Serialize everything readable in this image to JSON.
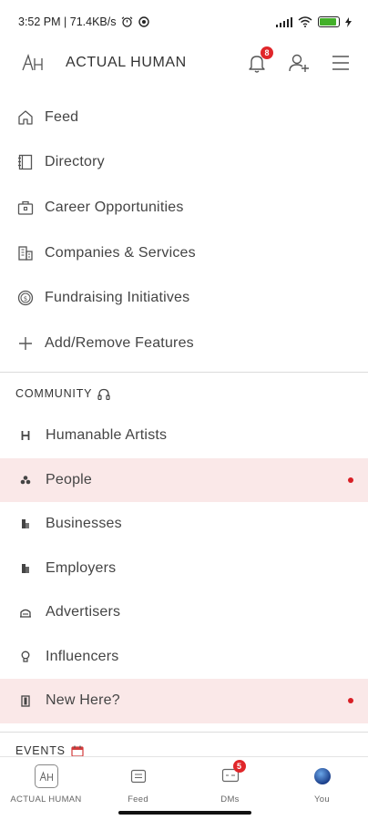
{
  "status_bar": {
    "time_speed": "3:52 PM | 71.4KB/s",
    "battery_level": 0.9,
    "colors": {
      "battery": "#43b02a"
    }
  },
  "header": {
    "logo_text": "AH",
    "title": "ACTUAL HUMAN",
    "notification_count": "8",
    "icons": [
      "bell-icon",
      "add-user-icon",
      "hamburger-menu-icon"
    ]
  },
  "menu": {
    "items": [
      {
        "label": "Feed",
        "icon": "home-icon"
      },
      {
        "label": "Directory",
        "icon": "directory-icon"
      },
      {
        "label": "Career Opportunities",
        "icon": "briefcase-icon"
      },
      {
        "label": "Companies & Services",
        "icon": "building-icon"
      },
      {
        "label": "Fundraising Initiatives",
        "icon": "dollar-coin-icon"
      },
      {
        "label": "Add/Remove Features",
        "icon": "plus-icon"
      }
    ]
  },
  "community": {
    "header": "COMMUNITY",
    "header_icon": "headphones-icon",
    "items": [
      {
        "label": "Humanable Artists",
        "icon": "h-icon",
        "highlighted": false
      },
      {
        "label": "People",
        "icon": "people-icon",
        "highlighted": true,
        "unread_dot": true
      },
      {
        "label": "Businesses",
        "icon": "business-icon",
        "highlighted": false
      },
      {
        "label": "Employers",
        "icon": "employer-icon",
        "highlighted": false
      },
      {
        "label": "Advertisers",
        "icon": "advertiser-icon",
        "highlighted": false
      },
      {
        "label": "Influencers",
        "icon": "influencer-icon",
        "highlighted": false
      },
      {
        "label": "New Here?",
        "icon": "door-icon",
        "highlighted": true,
        "unread_dot": true
      }
    ]
  },
  "events": {
    "header": "EVENTS",
    "header_icon": "calendar-icon"
  },
  "bottom_nav": {
    "tabs": [
      {
        "label": "ACTUAL HUMAN",
        "icon": "ah-logo-icon"
      },
      {
        "label": "Feed",
        "icon": "feed-icon"
      },
      {
        "label": "DMs",
        "icon": "chat-icon",
        "badge": "5"
      },
      {
        "label": "You",
        "icon": "avatar-icon"
      }
    ]
  },
  "colors": {
    "accent_red": "#e0262a",
    "highlight_bg": "#fae8e8",
    "unread_dot": "#d81f26"
  }
}
